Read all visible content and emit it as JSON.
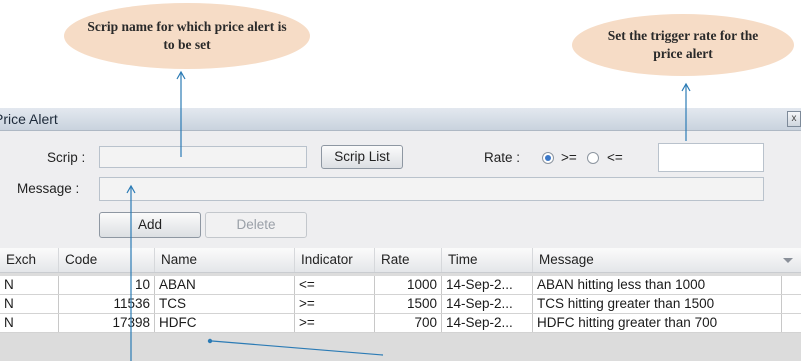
{
  "callouts": {
    "scrip_note": "Scrip name for which price alert is to be set",
    "rate_note": "Set the trigger rate for the price alert"
  },
  "window": {
    "title": "Price Alert",
    "close_glyph": "x"
  },
  "form": {
    "scrip_label": "Scrip :",
    "scrip_value": "",
    "scrip_list_button": "Scrip List",
    "rate_label": "Rate :",
    "rate_options": [
      ">=",
      "<="
    ],
    "rate_selected": ">=",
    "rate_value": "",
    "message_label": "Message :",
    "message_value": "",
    "add_button": "Add",
    "delete_button": "Delete"
  },
  "table": {
    "columns": [
      "Exch",
      "Code",
      "Name",
      "Indicator",
      "Rate",
      "Time",
      "Message"
    ],
    "rows": [
      {
        "exch": "N",
        "code": "10",
        "name": "ABAN",
        "indicator": "<=",
        "rate": "1000",
        "time": "14-Sep-2...",
        "message": "ABAN hitting less than 1000"
      },
      {
        "exch": "N",
        "code": "11536",
        "name": "TCS",
        "indicator": ">=",
        "rate": "1500",
        "time": "14-Sep-2...",
        "message": "TCS hitting greater than 1500"
      },
      {
        "exch": "N",
        "code": "17398",
        "name": "HDFC",
        "indicator": ">=",
        "rate": "700",
        "time": "14-Sep-2...",
        "message": "HDFC hitting greater than 700"
      }
    ]
  },
  "colors": {
    "callout_bg": "#f6dcc6",
    "pointer": "#2b7bb5",
    "radio_selected": "#3b78c8"
  },
  "icons": {
    "sort": "chevron-down-icon",
    "close": "close-icon"
  }
}
